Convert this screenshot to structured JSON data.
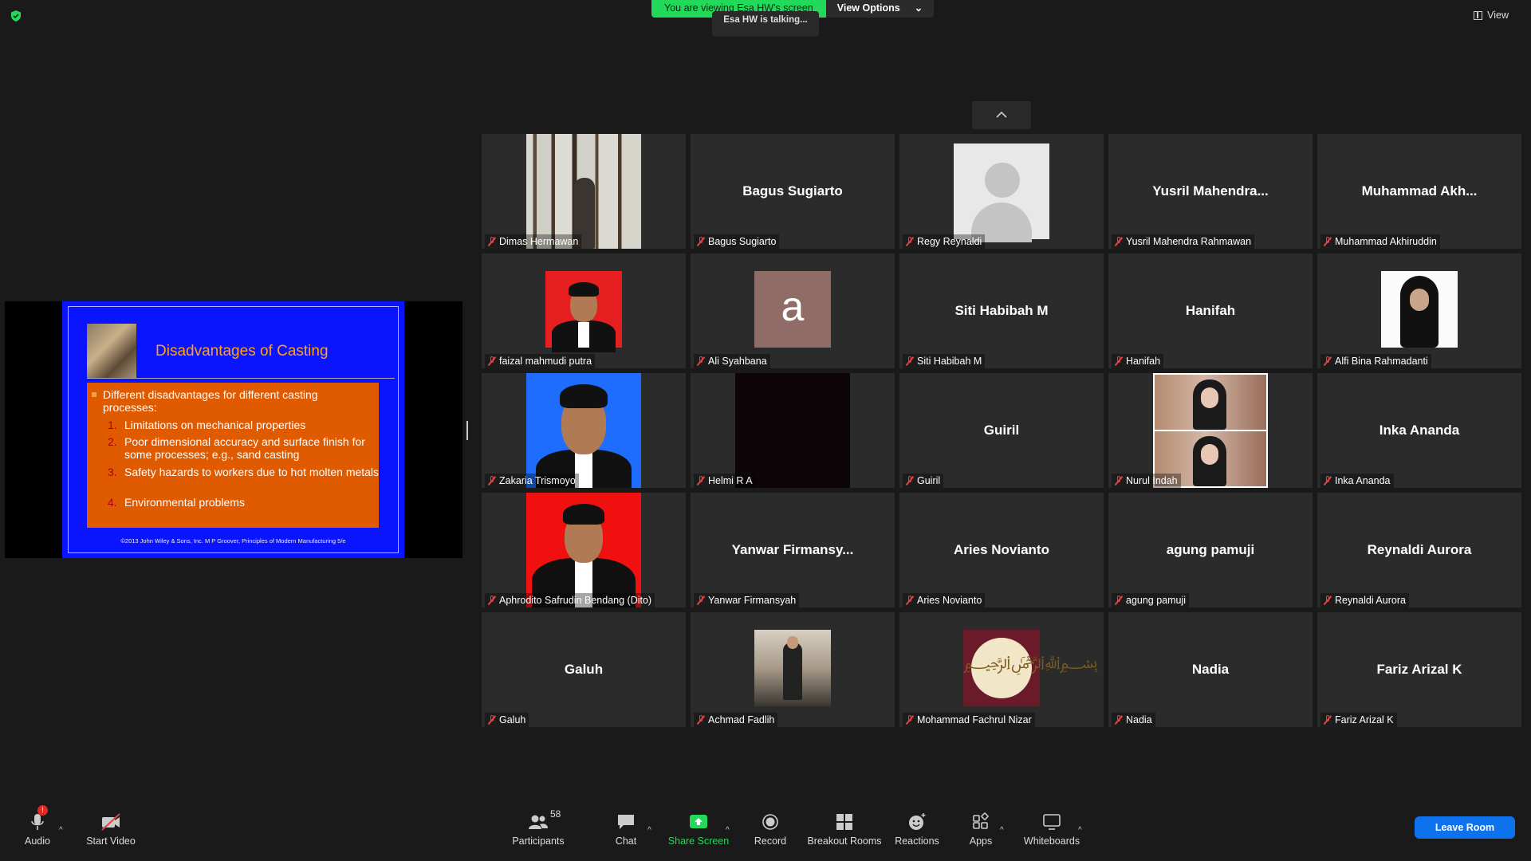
{
  "banner": {
    "viewing_text": "You are viewing Esa HW's screen",
    "view_options_label": "View Options",
    "talking_text": "Esa HW is talking...",
    "view_label": "View"
  },
  "slide": {
    "title": "Disadvantages of Casting",
    "bullet": "Different disadvantages for different casting processes:",
    "items": [
      {
        "num": "1.",
        "text": "Limitations on mechanical properties"
      },
      {
        "num": "2.",
        "text": "Poor dimensional accuracy and surface finish for some processes; e.g., sand casting"
      },
      {
        "num": "3.",
        "text": "Safety hazards to workers due to hot molten metals"
      },
      {
        "num": "4.",
        "text": "Environmental problems"
      }
    ],
    "footer": "©2013 John Wiley & Sons, Inc.  M P Groover, Principles of Modern Manufacturing 5/e"
  },
  "participants": [
    {
      "label": "Dimas Hermawan",
      "big": "",
      "photo": "forest"
    },
    {
      "label": "Bagus Sugiarto",
      "big": "Bagus Sugiarto",
      "photo": ""
    },
    {
      "label": "Regy Reynaldi",
      "big": "",
      "photo": "avatar"
    },
    {
      "label": "Yusril Mahendra Rahmawan",
      "big": "Yusril  Mahendra...",
      "photo": ""
    },
    {
      "label": "Muhammad Akhiruddin",
      "big": "Muhammad  Akh...",
      "photo": ""
    },
    {
      "label": "faizal mahmudi putra",
      "big": "",
      "photo": "red1"
    },
    {
      "label": "Ali Syahbana",
      "big": "",
      "photo": "letter",
      "letter": "a"
    },
    {
      "label": "Siti Habibah M",
      "big": "Siti Habibah M",
      "photo": ""
    },
    {
      "label": "Hanifah",
      "big": "Hanifah",
      "photo": ""
    },
    {
      "label": "Alfi Bina Rahmadanti",
      "big": "",
      "photo": "hijab"
    },
    {
      "label": "Zakaria Trismoyo",
      "big": "",
      "photo": "blue"
    },
    {
      "label": "Helmi R A",
      "big": "",
      "photo": "dark"
    },
    {
      "label": "Guiril",
      "big": "Guiril",
      "photo": ""
    },
    {
      "label": "Nurul Indah",
      "big": "",
      "photo": "nurul"
    },
    {
      "label": "Inka Ananda",
      "big": "Inka Ananda",
      "photo": ""
    },
    {
      "label": "Aphrodito Safrudin Bendang (Dito)",
      "big": "",
      "photo": "red2"
    },
    {
      "label": "Yanwar Firmansyah",
      "big": "Yanwar  Firmansy...",
      "photo": ""
    },
    {
      "label": "Aries Novianto",
      "big": "Aries Novianto",
      "photo": ""
    },
    {
      "label": "agung pamuji",
      "big": "agung pamuji",
      "photo": ""
    },
    {
      "label": "Reynaldi Aurora",
      "big": "Reynaldi Aurora",
      "photo": ""
    },
    {
      "label": "Galuh",
      "big": "Galuh",
      "photo": ""
    },
    {
      "label": "Achmad Fadlih",
      "big": "",
      "photo": "office"
    },
    {
      "label": "Mohammad Fachrul Nizar",
      "big": "",
      "photo": "calli"
    },
    {
      "label": "Nadia",
      "big": "Nadia",
      "photo": ""
    },
    {
      "label": "Fariz Arizal K",
      "big": "Fariz Arizal K",
      "photo": ""
    }
  ],
  "toolbar": {
    "audio": "Audio",
    "audio_badge": "!",
    "start_video": "Start Video",
    "participants": "Participants",
    "participants_count": "58",
    "chat": "Chat",
    "share_screen": "Share Screen",
    "record": "Record",
    "breakout_rooms": "Breakout Rooms",
    "reactions": "Reactions",
    "apps": "Apps",
    "whiteboards": "Whiteboards",
    "leave_room": "Leave Room"
  }
}
